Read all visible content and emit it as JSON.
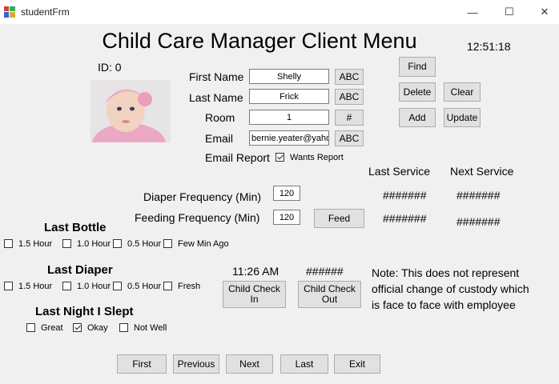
{
  "window": {
    "title": "studentFrm",
    "minimize": "—",
    "maximize": "☐",
    "close": "✕"
  },
  "header": {
    "title": "Child Care Manager Client Menu",
    "time": "12:51:18"
  },
  "client": {
    "id_label": "ID: 0"
  },
  "fields": {
    "first_name": {
      "label": "First Name",
      "value": "Shelly",
      "button": "ABC"
    },
    "last_name": {
      "label": "Last Name",
      "value": "Frick",
      "button": "ABC"
    },
    "room": {
      "label": "Room",
      "value": "1",
      "button": "#"
    },
    "email": {
      "label": "Email",
      "value": "bernie.yeater@yahoo",
      "button": "ABC"
    },
    "email_report": {
      "label": "Email Report",
      "checkbox": "Wants Report"
    }
  },
  "actions": {
    "find": "Find",
    "delete": "Delete",
    "clear": "Clear",
    "add": "Add",
    "update": "Update"
  },
  "service": {
    "last_header": "Last Service",
    "next_header": "Next Service",
    "diaper_label": "Diaper Frequency (Min)",
    "diaper_value": "120",
    "feeding_label": "Feeding Frequency (Min)",
    "feeding_value": "120",
    "feed_button": "Feed",
    "diaper_last": "#######",
    "diaper_next": "#######",
    "feeding_last": "#######",
    "feeding_next": "#######"
  },
  "last_bottle": {
    "heading": "Last Bottle",
    "options": [
      "1.5 Hour",
      "1.0 Hour",
      "0.5 Hour",
      "Few Min Ago"
    ]
  },
  "last_diaper": {
    "heading": "Last Diaper",
    "options": [
      "1.5 Hour",
      "1.0 Hour",
      "0.5 Hour",
      "Fresh"
    ]
  },
  "last_night": {
    "heading": "Last Night I Slept",
    "options": [
      "Great",
      "Okay",
      "Not Well"
    ]
  },
  "checkin": {
    "time": "11:26 AM",
    "status": "######",
    "check_in": "Child Check In",
    "check_out": "Child Check Out",
    "note": "Note:  This does not represent official change of custody which is face to face with employee"
  },
  "nav": {
    "first": "First",
    "previous": "Previous",
    "next": "Next",
    "last": "Last",
    "exit": "Exit"
  },
  "colors": {
    "background": "#f0f0f0",
    "button": "#e1e1e1",
    "photo_pink": "#e8a9c0"
  }
}
